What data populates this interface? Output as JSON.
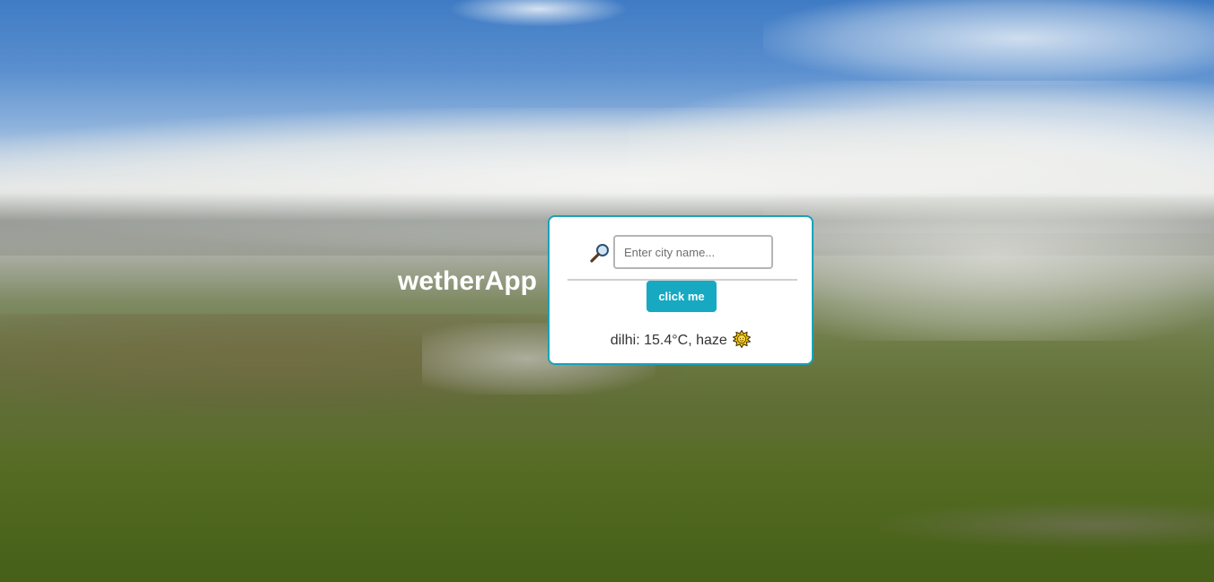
{
  "app": {
    "title": "wetherApp"
  },
  "search": {
    "placeholder": "Enter city name...",
    "value": "",
    "icon": "magnifying-glass-icon",
    "button_label": "click me"
  },
  "result": {
    "text": "dilhi: 15.4°C, haze",
    "icon": "sun-icon"
  },
  "colors": {
    "accent": "#17a9c2",
    "card_border": "#17a2b8",
    "title": "#ffffff"
  }
}
